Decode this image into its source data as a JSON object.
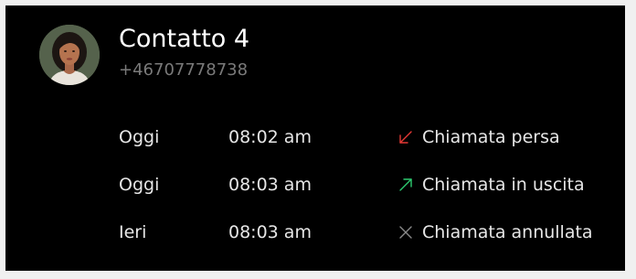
{
  "contact": {
    "name": "Contatto 4",
    "phone": "+46707778738"
  },
  "calls": [
    {
      "day": "Oggi",
      "time": "08:02 am",
      "icon": "missed-call-arrow-icon",
      "icon_color": "#e53935",
      "label": "Chiamata persa"
    },
    {
      "day": "Oggi",
      "time": "08:03 am",
      "icon": "outgoing-call-arrow-icon",
      "icon_color": "#2ecc71",
      "label": "Chiamata in uscita"
    },
    {
      "day": "Ieri",
      "time": "08:03 am",
      "icon": "cancelled-call-x-icon",
      "icon_color": "#8a8a8a",
      "label": "Chiamata annullata"
    }
  ],
  "colors": {
    "background": "#000000",
    "primary_text": "#e6e6e6",
    "secondary_text": "#7a7a7a"
  }
}
